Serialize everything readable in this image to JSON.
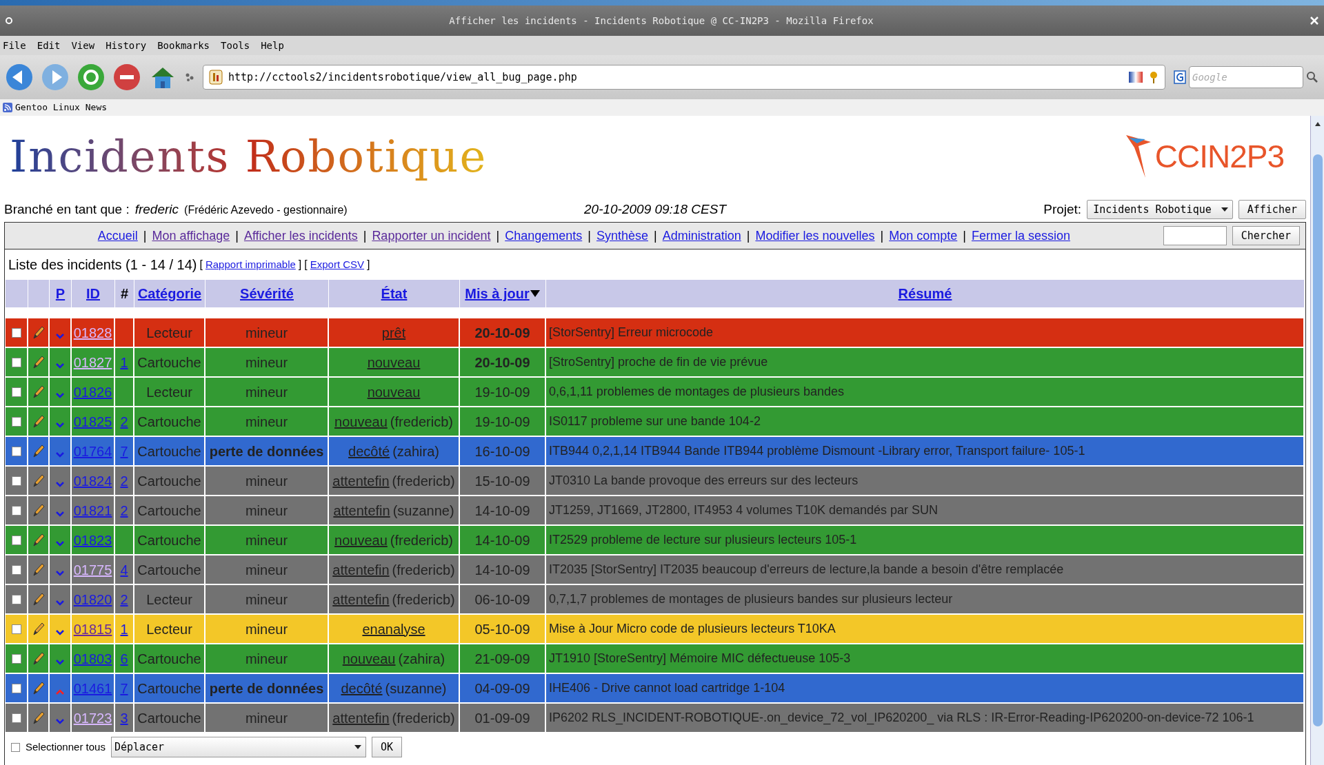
{
  "window": {
    "title": "Afficher les incidents - Incidents Robotique @ CC-IN2P3 - Mozilla Firefox"
  },
  "menu": [
    "File",
    "Edit",
    "View",
    "History",
    "Bookmarks",
    "Tools",
    "Help"
  ],
  "address": "http://cctools2/incidentsrobotique/view_all_bug_page.php",
  "search_placeholder": "Google",
  "bookmarks": [
    "Gentoo Linux News"
  ],
  "site": {
    "title": "Incidents Robotique",
    "org_logo": "CCIN2P3"
  },
  "login": {
    "label": "Branché en tant que :",
    "user": "frederic",
    "detail": "(Frédéric Azevedo - gestionnaire)",
    "datetime": "20-10-2009 09:18 CEST",
    "project_label": "Projet:",
    "project": "Incidents Robotique",
    "show_button": "Afficher"
  },
  "nav": [
    {
      "label": "Accueil",
      "visited": false
    },
    {
      "label": "Mon affichage",
      "visited": true
    },
    {
      "label": "Afficher les incidents",
      "visited": true
    },
    {
      "label": "Rapporter un incident",
      "visited": true
    },
    {
      "label": "Changements",
      "visited": false
    },
    {
      "label": "Synthèse",
      "visited": false
    },
    {
      "label": "Administration",
      "visited": false
    },
    {
      "label": "Modifier les nouvelles",
      "visited": false
    },
    {
      "label": "Mon compte",
      "visited": false
    },
    {
      "label": "Fermer la session",
      "visited": false
    }
  ],
  "search_button": "Chercher",
  "list": {
    "title": "Liste des incidents (1 - 14 / 14)",
    "links": [
      {
        "open": "[",
        "label": "Rapport imprimable",
        "close": "]"
      },
      {
        "open": "[",
        "label": "Export CSV",
        "close": "]"
      }
    ]
  },
  "nav_separator": "|",
  "columns": [
    "P",
    "ID",
    "#",
    "Catégorie",
    "Sévérité",
    "État",
    "Mis à jour",
    "Résumé"
  ],
  "rows": [
    {
      "color": "#d52f12",
      "checked": false,
      "priority_high": false,
      "id": "01828",
      "visited": true,
      "notes": "",
      "category": "Lecteur",
      "severity": "mineur",
      "major": false,
      "status": "prêt",
      "handler": "",
      "date": "20-10-09",
      "recent": true,
      "summary": "[StorSentry] Erreur microcode"
    },
    {
      "color": "#339a33",
      "checked": false,
      "priority_high": false,
      "id": "01827",
      "visited": true,
      "notes": "1",
      "category": "Cartouche",
      "severity": "mineur",
      "major": false,
      "status": "nouveau",
      "handler": "",
      "date": "20-10-09",
      "recent": true,
      "summary": "[StroSentry] proche de fin de vie prévue"
    },
    {
      "color": "#339a33",
      "checked": false,
      "priority_high": false,
      "id": "01826",
      "visited": false,
      "notes": "",
      "category": "Lecteur",
      "severity": "mineur",
      "major": false,
      "status": "nouveau",
      "handler": "",
      "date": "19-10-09",
      "recent": false,
      "summary": "0,6,1,11 problemes de montages de plusieurs bandes"
    },
    {
      "color": "#339a33",
      "checked": false,
      "priority_high": false,
      "id": "01825",
      "visited": false,
      "notes": "2",
      "category": "Cartouche",
      "severity": "mineur",
      "major": false,
      "status": "nouveau",
      "handler": "(fredericb)",
      "date": "19-10-09",
      "recent": false,
      "summary": "IS0117 probleme sur une bande 104-2"
    },
    {
      "color": "#3169cf",
      "checked": false,
      "priority_high": false,
      "id": "01764",
      "visited": false,
      "notes": "7",
      "category": "Cartouche",
      "severity": "perte de données",
      "major": true,
      "status": "decôté",
      "handler": "(zahira)",
      "date": "16-10-09",
      "recent": false,
      "summary": "ITB944 0,2,1,14 ITB944 Bande ITB944 problème Dismount -Library error, Transport failure- 105-1"
    },
    {
      "color": "#727272",
      "checked": false,
      "priority_high": false,
      "id": "01824",
      "visited": false,
      "notes": "2",
      "category": "Cartouche",
      "severity": "mineur",
      "major": false,
      "status": "attentefin",
      "handler": "(fredericb)",
      "date": "15-10-09",
      "recent": false,
      "summary": "JT0310 La bande provoque des erreurs sur des lecteurs"
    },
    {
      "color": "#727272",
      "checked": false,
      "priority_high": false,
      "id": "01821",
      "visited": false,
      "notes": "2",
      "category": "Cartouche",
      "severity": "mineur",
      "major": false,
      "status": "attentefin",
      "handler": "(suzanne)",
      "date": "14-10-09",
      "recent": false,
      "summary": "JT1259, JT1669, JT2800, IT4953 4 volumes T10K demandés par SUN"
    },
    {
      "color": "#339a33",
      "checked": false,
      "priority_high": false,
      "id": "01823",
      "visited": false,
      "notes": "",
      "category": "Cartouche",
      "severity": "mineur",
      "major": false,
      "status": "nouveau",
      "handler": "(fredericb)",
      "date": "14-10-09",
      "recent": false,
      "summary": "IT2529 probleme de lecture sur plusieurs lecteurs 105-1"
    },
    {
      "color": "#727272",
      "checked": false,
      "priority_high": false,
      "id": "01775",
      "visited": true,
      "notes": "4",
      "category": "Cartouche",
      "severity": "mineur",
      "major": false,
      "status": "attentefin",
      "handler": "(fredericb)",
      "date": "14-10-09",
      "recent": false,
      "summary": "IT2035 [StorSentry] IT2035 beaucoup d'erreurs de lecture,la bande a besoin d'être remplacée"
    },
    {
      "color": "#727272",
      "checked": false,
      "priority_high": false,
      "id": "01820",
      "visited": false,
      "notes": "2",
      "category": "Lecteur",
      "severity": "mineur",
      "major": false,
      "status": "attentefin",
      "handler": "(fredericb)",
      "date": "06-10-09",
      "recent": false,
      "summary": "0,7,1,7 problemes de montages de plusieurs bandes sur plusieurs lecteur"
    },
    {
      "color": "#f3c728",
      "checked": false,
      "priority_high": false,
      "id": "01815",
      "visited": true,
      "notes": "1",
      "category": "Lecteur",
      "severity": "mineur",
      "major": false,
      "status": "enanalyse",
      "handler": "",
      "date": "05-10-09",
      "recent": false,
      "summary": "Mise à Jour Micro code de plusieurs lecteurs T10KA"
    },
    {
      "color": "#339a33",
      "checked": false,
      "priority_high": false,
      "id": "01803",
      "visited": false,
      "notes": "6",
      "category": "Cartouche",
      "severity": "mineur",
      "major": false,
      "status": "nouveau",
      "handler": "(zahira)",
      "date": "21-09-09",
      "recent": false,
      "summary": "JT1910 [StoreSentry] Mémoire MIC défectueuse 105-3"
    },
    {
      "color": "#3169cf",
      "checked": false,
      "priority_high": true,
      "id": "01461",
      "visited": false,
      "notes": "7",
      "category": "Cartouche",
      "severity": "perte de données",
      "major": true,
      "status": "decôté",
      "handler": "(suzanne)",
      "date": "04-09-09",
      "recent": false,
      "summary": "IHE406 - Drive cannot load cartridge 1-104"
    },
    {
      "color": "#727272",
      "checked": false,
      "priority_high": false,
      "id": "01723",
      "visited": true,
      "notes": "3",
      "category": "Cartouche",
      "severity": "mineur",
      "major": false,
      "status": "attentefin",
      "handler": "(fredericb)",
      "date": "01-09-09",
      "recent": false,
      "summary": "IP6202 RLS_INCIDENT-ROBOTIQUE-.on_device_72_vol_IP620200_ via RLS : IR-Error-Reading-IP620200-on-device-72 106-1"
    }
  ],
  "footer": {
    "select_all": "Selectionner tous",
    "select_all_checked": false,
    "action": "Déplacer",
    "ok": "OK"
  }
}
